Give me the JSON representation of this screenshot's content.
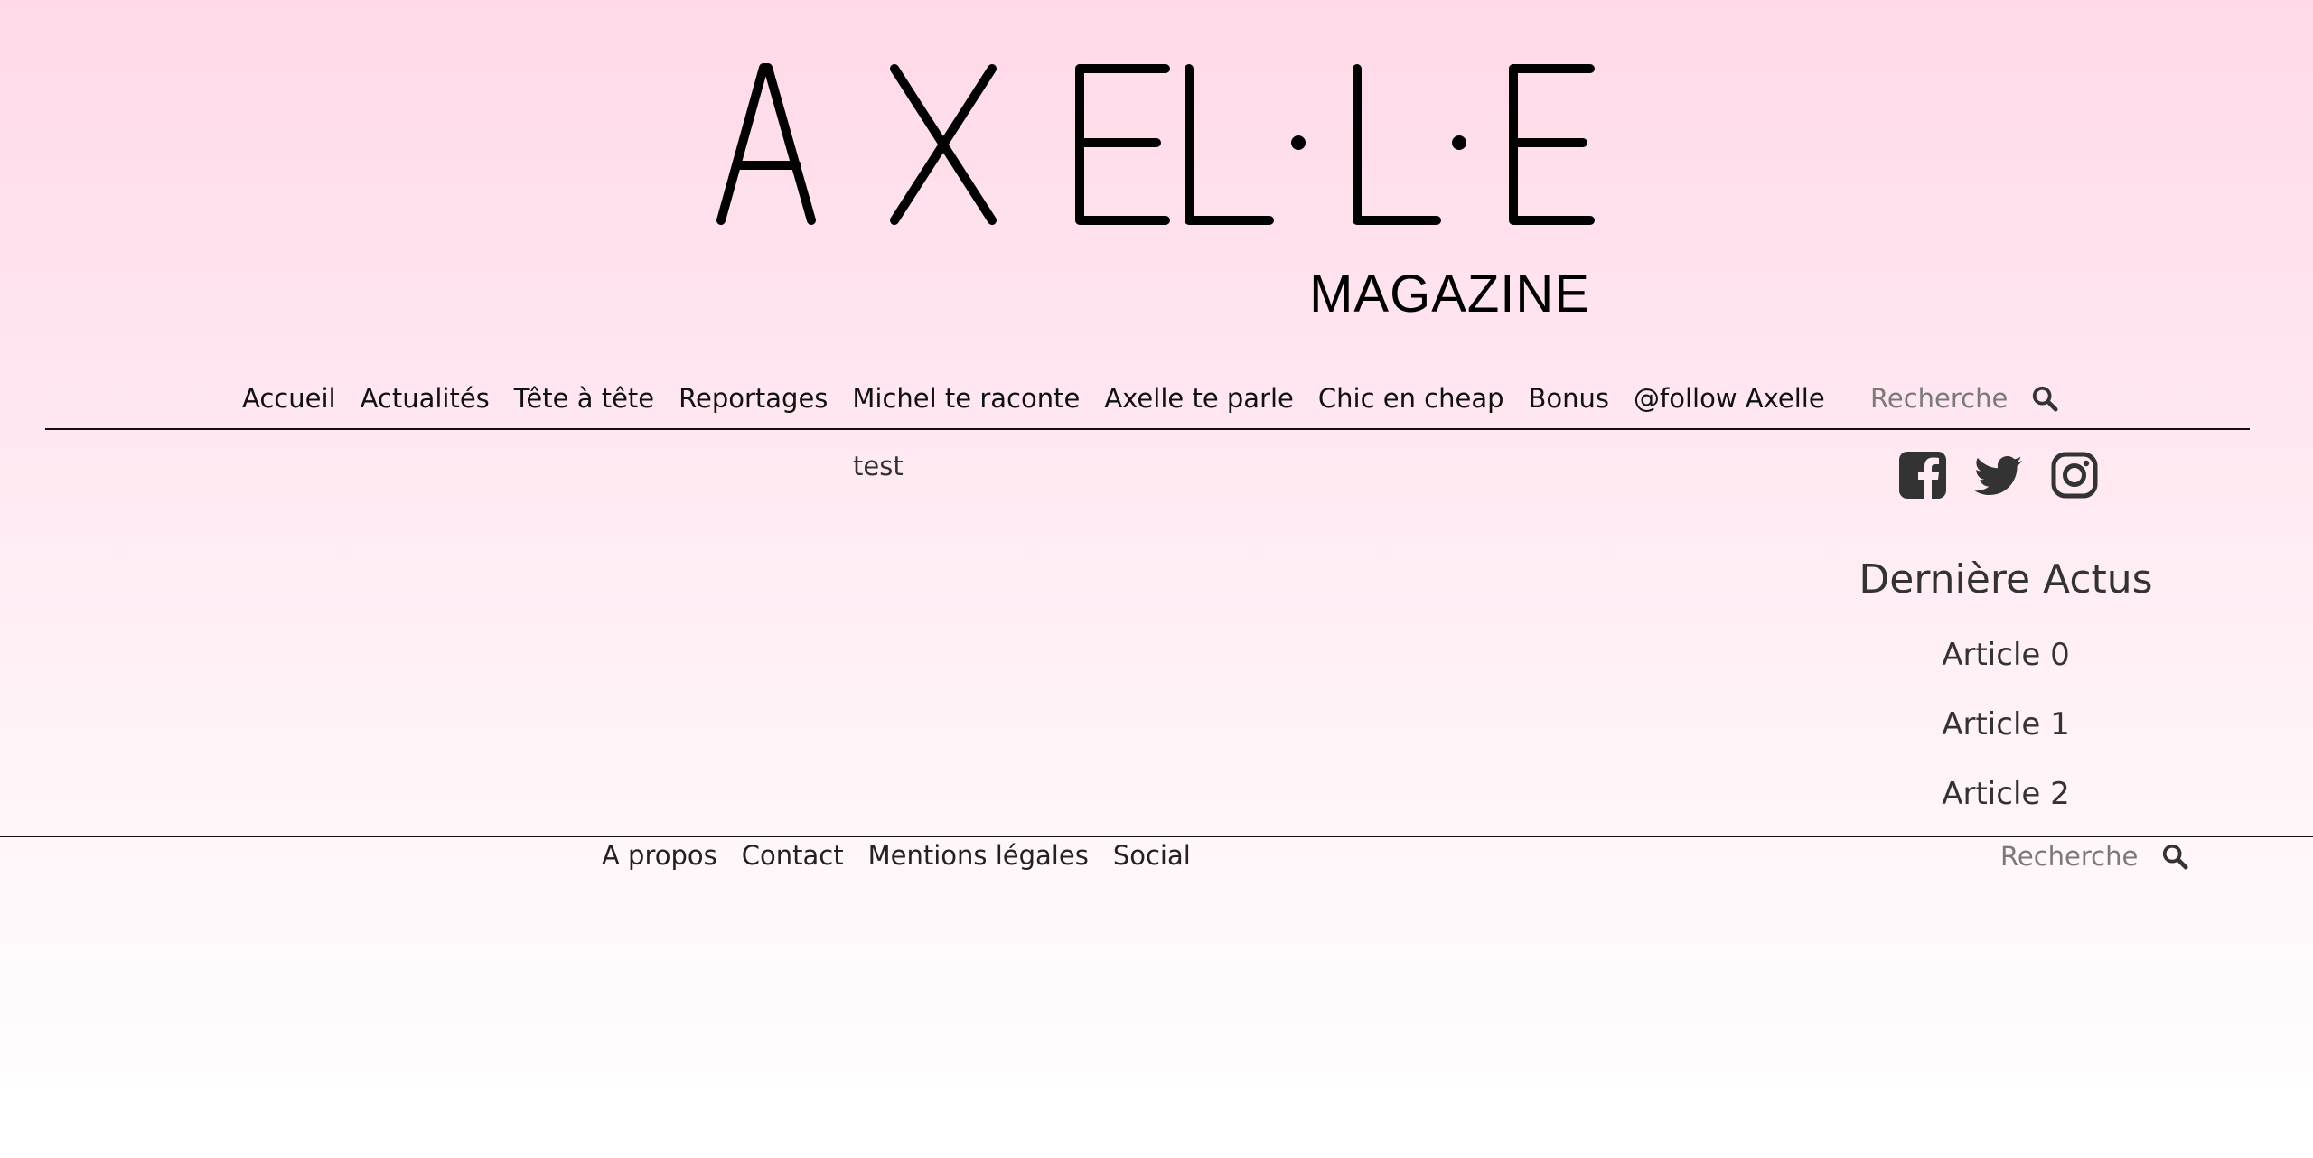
{
  "brand": {
    "logo_main": "AXEL·L·E",
    "logo_sub": "MAGAZINE"
  },
  "nav": {
    "items": [
      {
        "label": "Accueil"
      },
      {
        "label": "Actualités"
      },
      {
        "label": "Tête à tête"
      },
      {
        "label": "Reportages"
      },
      {
        "label": "Michel te raconte"
      },
      {
        "label": "Axelle te parle"
      },
      {
        "label": "Chic en cheap"
      },
      {
        "label": "Bonus"
      },
      {
        "label": "@follow Axelle"
      }
    ],
    "search_placeholder": "Recherche",
    "search_icon": "search-icon"
  },
  "main": {
    "content_text": "test"
  },
  "sidebar": {
    "social_icons": [
      "facebook-icon",
      "twitter-icon",
      "instagram-icon"
    ],
    "title": "Dernière Actus",
    "articles": [
      {
        "label": "Article 0"
      },
      {
        "label": "Article 1"
      },
      {
        "label": "Article 2"
      }
    ]
  },
  "footer": {
    "links": [
      {
        "label": "A propos"
      },
      {
        "label": "Contact"
      },
      {
        "label": "Mentions légales"
      },
      {
        "label": "Social"
      }
    ],
    "search_placeholder": "Recherche"
  },
  "colors": {
    "background_top": "#ffd9e9",
    "background_bottom": "#ffffff",
    "text": "#2b2b2b",
    "rule": "#111111"
  }
}
